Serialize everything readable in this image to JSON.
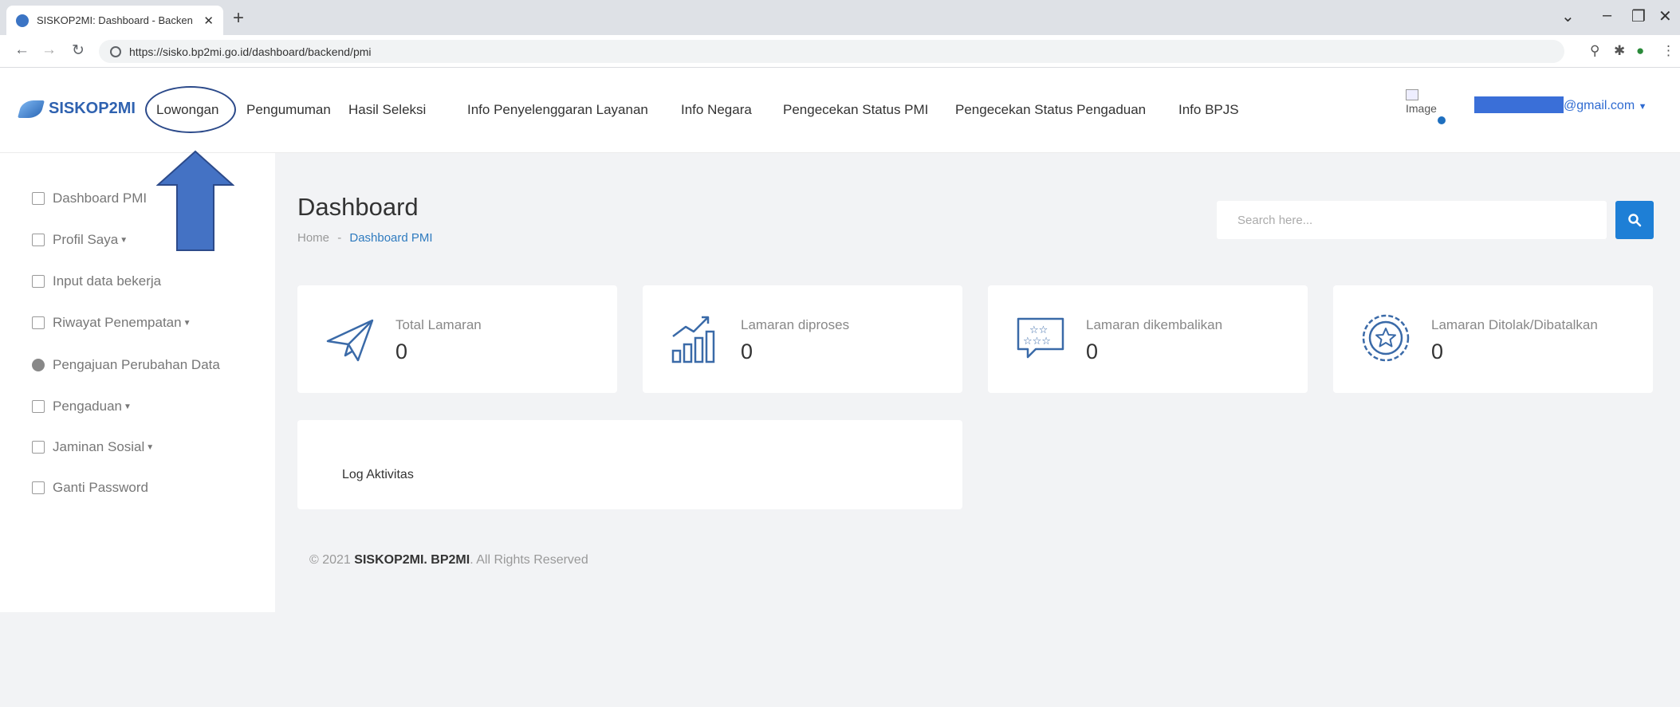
{
  "browser": {
    "tab_title": "SISKOP2MI: Dashboard - Backen",
    "url": "https://sisko.bp2mi.go.id/dashboard/backend/pmi"
  },
  "brand": {
    "name": "SISKOP2MI"
  },
  "menu": {
    "items": [
      "Lowongan",
      "Pengumuman",
      "Hasil Seleksi",
      "Info Penyelenggaran Layanan",
      "Info Negara",
      "Pengecekan Status PMI",
      "Pengecekan Status Pengaduan",
      "Info BPJS"
    ]
  },
  "user": {
    "avatar_alt": "Image",
    "email_suffix": "@gmail.com"
  },
  "sidebar": {
    "items": [
      "Dashboard PMI",
      "Profil Saya",
      "Input data bekerja",
      "Riwayat Penempatan",
      "Pengajuan Perubahan Data",
      "Pengaduan",
      "Jaminan Sosial",
      "Ganti Password"
    ]
  },
  "main": {
    "title": "Dashboard",
    "breadcrumb_home": "Home",
    "breadcrumb_sep": "-",
    "breadcrumb_current": "Dashboard PMI",
    "search_placeholder": "Search here..."
  },
  "stats": [
    {
      "label": "Total Lamaran",
      "value": "0",
      "icon": "paper-plane-icon"
    },
    {
      "label": "Lamaran diproses",
      "value": "0",
      "icon": "growth-chart-icon"
    },
    {
      "label": "Lamaran dikembalikan",
      "value": "0",
      "icon": "rating-stars-icon"
    },
    {
      "label": "Lamaran Ditolak/Dibatalkan",
      "value": "0",
      "icon": "badge-star-icon"
    }
  ],
  "log": {
    "title": "Log Aktivitas"
  },
  "footer": {
    "prefix": "© 2021",
    "brand": "SISKOP2MI. BP2MI",
    "suffix": "All Rights Reserved"
  },
  "colors": {
    "accent": "#1e7fd6",
    "brand": "#2f62b0",
    "annotation": "#3a6bc6"
  }
}
